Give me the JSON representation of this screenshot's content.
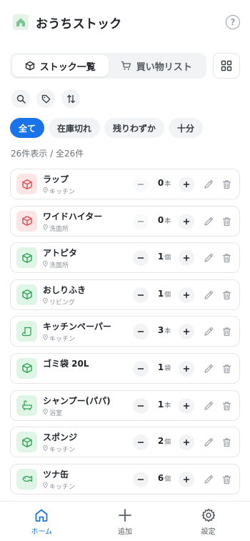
{
  "app": {
    "title": "おうちストック"
  },
  "tabs": [
    {
      "label": "ストック一覧",
      "icon": "cube-icon",
      "active": true
    },
    {
      "label": "買い物リスト",
      "icon": "cart-icon",
      "active": false
    }
  ],
  "filters": [
    {
      "label": "全て",
      "active": true
    },
    {
      "label": "在庫切れ",
      "active": false
    },
    {
      "label": "残りわずか",
      "active": false
    },
    {
      "label": "十分",
      "active": false
    }
  ],
  "count_text": "26件表示 / 全26件",
  "items": [
    {
      "name": "ラップ",
      "location": "キッチン",
      "qty": "0",
      "unit": "本",
      "icon": "box-icon",
      "status": "red"
    },
    {
      "name": "ワイドハイター",
      "location": "洗面所",
      "qty": "0",
      "unit": "本",
      "icon": "box-icon",
      "status": "red"
    },
    {
      "name": "アトピタ",
      "location": "洗面所",
      "qty": "1",
      "unit": "個",
      "icon": "box-icon",
      "status": "green"
    },
    {
      "name": "おしりふき",
      "location": "リビング",
      "qty": "1",
      "unit": "個",
      "icon": "box-icon",
      "status": "green"
    },
    {
      "name": "キッチンペーパー",
      "location": "キッチン",
      "qty": "3",
      "unit": "本",
      "icon": "scroll-icon",
      "status": "green"
    },
    {
      "name": "ゴミ袋 20L",
      "location": "",
      "qty": "1",
      "unit": "袋",
      "icon": "box-icon",
      "status": "green"
    },
    {
      "name": "シャンプー(パパ)",
      "location": "浴室",
      "qty": "1",
      "unit": "本",
      "icon": "bath-icon",
      "status": "green"
    },
    {
      "name": "スポンジ",
      "location": "キッチン",
      "qty": "2",
      "unit": "個",
      "icon": "box-icon",
      "status": "green"
    },
    {
      "name": "ツナ缶",
      "location": "キッチン",
      "qty": "6",
      "unit": "個",
      "icon": "fish-icon",
      "status": "green"
    }
  ],
  "nav": [
    {
      "label": "ホーム",
      "icon": "home-icon",
      "active": true
    },
    {
      "label": "追加",
      "icon": "plus-icon",
      "active": false
    },
    {
      "label": "設定",
      "icon": "gear-icon",
      "active": false
    }
  ],
  "colors": {
    "accent": "#1a73e8",
    "status_red_bg": "#fde5e5",
    "status_red_fg": "#e5484d",
    "status_green_bg": "#dff5e5",
    "status_green_fg": "#2fa352"
  }
}
